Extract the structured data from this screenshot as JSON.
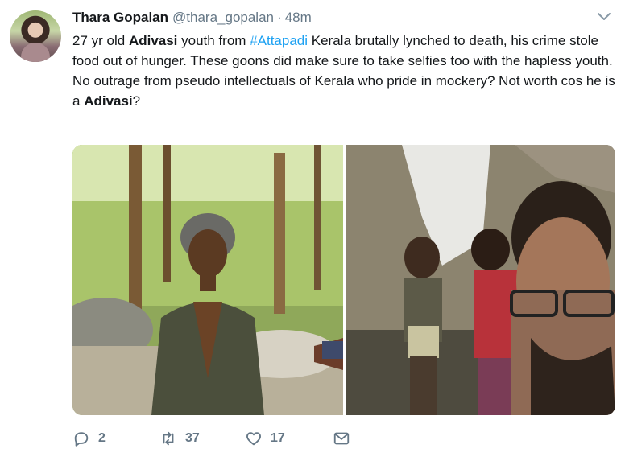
{
  "tweet": {
    "author_name": "Thara Gopalan",
    "author_handle": "@thara_gopalan",
    "separator": "·",
    "timestamp": "48m",
    "body": {
      "p1_a": "27 yr old ",
      "p1_b": "Adivasi",
      "p1_c": " youth from ",
      "p1_hashtag": "#Attapadi",
      "p1_d": " Kerala brutally lynched to death, his crime stole food out of hunger. These goons did make sure to take selfies too with the hapless youth.",
      "p2_a": "No outrage from pseudo intellectuals of Kerala who pride in mockery? Not worth cos he is a ",
      "p2_b": "Adivasi",
      "p2_c": "?"
    },
    "actions": {
      "replies": "2",
      "retweets": "37",
      "likes": "17"
    }
  },
  "icons": {
    "menu": "chevron-down-icon",
    "reply": "reply-icon",
    "retweet": "retweet-icon",
    "like": "heart-icon",
    "dm": "envelope-icon"
  },
  "colors": {
    "text": "#14171a",
    "muted": "#657786",
    "link": "#1da1f2"
  }
}
